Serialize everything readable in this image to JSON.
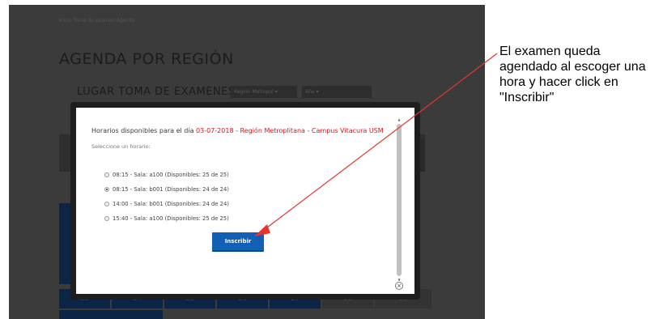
{
  "background": {
    "breadcrumb": "Inicio  Toma de examen Agenda",
    "title": "AGENDA POR REGIÓN",
    "subtitle": "LUGAR TOMA DE EXAMENES:",
    "region_select": "Región Metropol  ▾",
    "sede_select": "Año                ▾",
    "nav_arrow": "›",
    "calendar_days": [
      "23",
      "24",
      "25",
      "26",
      "27",
      "28",
      "29"
    ]
  },
  "modal": {
    "header_prefix": "Horarios disponibles para el día ",
    "header_date_location": "03-07-2018 - Región Metroplitana - Campus Vitacura USM",
    "prompt": "Seleccione un horario:",
    "options": [
      {
        "label": "08:15 - Sala: a100 (Disponibles: 25 de 25)",
        "checked": false
      },
      {
        "label": "08:15 - Sala: b001 (Disponibles: 24 de 24)",
        "checked": true
      },
      {
        "label": "14:00 - Sala: b001 (Disponibles: 24 de 24)",
        "checked": false
      },
      {
        "label": "15:40 - Sala: a100 (Disponibles: 25 de 25)",
        "checked": false
      }
    ],
    "submit_label": "Inscribir",
    "close_symbol": "×",
    "scroll_up_symbol": "▲",
    "scroll_down_symbol": "▼"
  },
  "annotation": {
    "text": "El examen queda agendado al escoger una hora y hacer click en \"Inscribir\"",
    "arrow_color": "#e8342c"
  }
}
